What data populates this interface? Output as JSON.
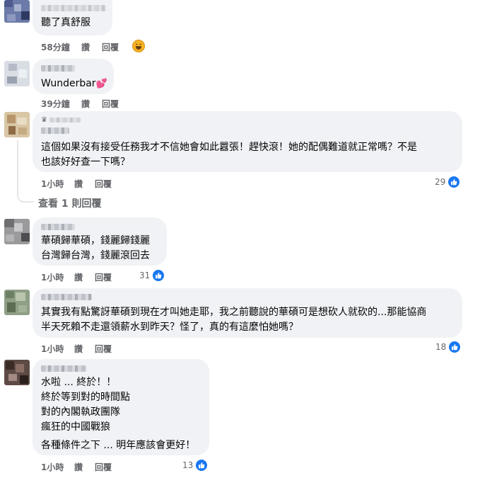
{
  "comments": [
    {
      "lines": [
        "聽了真舒服"
      ],
      "time": "58分鐘",
      "like": "讚",
      "reply": "回覆",
      "reaction": "haha"
    },
    {
      "lines": [
        "Wunderbar"
      ],
      "emoji": "💕",
      "time": "39分鐘",
      "like": "讚",
      "reply": "回覆"
    },
    {
      "lines": [
        "這個如果沒有接受任務我才不信她會如此囂張！趕快滾！她的配偶難道就正常嗎？不是",
        "也該好好查一下嗎？"
      ],
      "time": "1小時",
      "like": "讚",
      "reply": "回覆",
      "likes": "29",
      "view_replies": "查看 1 則回覆"
    },
    {
      "lines": [
        "華碩歸華碩，錢麗歸錢麗",
        "台灣歸台灣，錢麗滾回去"
      ],
      "time": "1小時",
      "like": "讚",
      "reply": "回覆",
      "likes": "31"
    },
    {
      "lines": [
        "其實我有點驚訝華碩到現在才叫她走耶，我之前聽說的華碩可是想砍人就砍的...那能協商",
        "半天死賴不走還領薪水到昨天？怪了，真的有這麼怕她嗎？"
      ],
      "time": "1小時",
      "like": "讚",
      "reply": "回覆",
      "likes": "18"
    },
    {
      "lines": [
        "水啦 ... 終於！！",
        "終於等到對的時間點",
        "對的內閣執政團隊",
        "瘋狂的中國戰狼",
        "各種條件之下 ... 明年應該會更好！"
      ],
      "time": "1小時",
      "like": "讚",
      "reply": "回覆",
      "likes": "13"
    }
  ],
  "icons": {
    "like": "thumbs-up-icon",
    "haha": "laugh-emoji-icon",
    "heart": "two-hearts-emoji"
  },
  "colors": {
    "bubble": "#f0f2f5",
    "meta": "#65676b",
    "like_blue": "#1877f2"
  }
}
